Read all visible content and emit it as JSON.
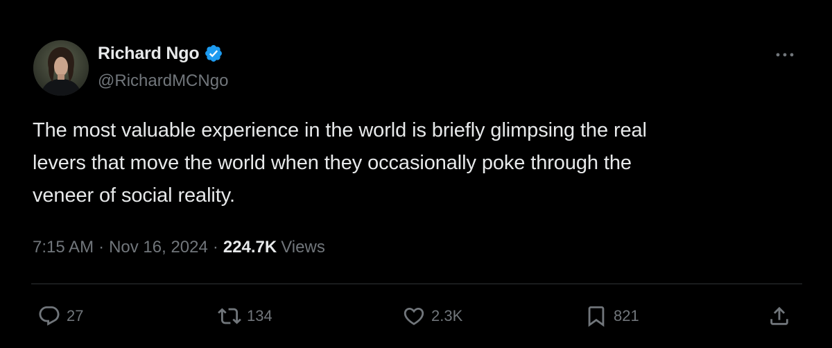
{
  "author": {
    "name": "Richard Ngo",
    "handle": "@RichardMCNgo",
    "verified": true,
    "verified_color": "#1d9bf0"
  },
  "tweet": {
    "text_lines": [
      "The most valuable experience in the world is briefly glimpsing the real",
      "levers that move the world when they occasionally poke through the",
      "veneer of social reality."
    ],
    "time": "7:15 AM",
    "separator": "·",
    "date": "Nov 16, 2024",
    "views_count": "224.7K",
    "views_label": "Views"
  },
  "actions": {
    "replies": "27",
    "reposts": "134",
    "likes": "2.3K",
    "bookmarks": "821"
  },
  "icons": {
    "more": "more-horizontal-icon",
    "verified": "verified-badge-icon",
    "reply": "reply-icon",
    "repost": "repost-icon",
    "like": "heart-icon",
    "bookmark": "bookmark-icon",
    "share": "share-icon"
  },
  "colors": {
    "background": "#000000",
    "text_primary": "#e7e9ea",
    "text_secondary": "#71767b",
    "divider": "#2f3336"
  }
}
